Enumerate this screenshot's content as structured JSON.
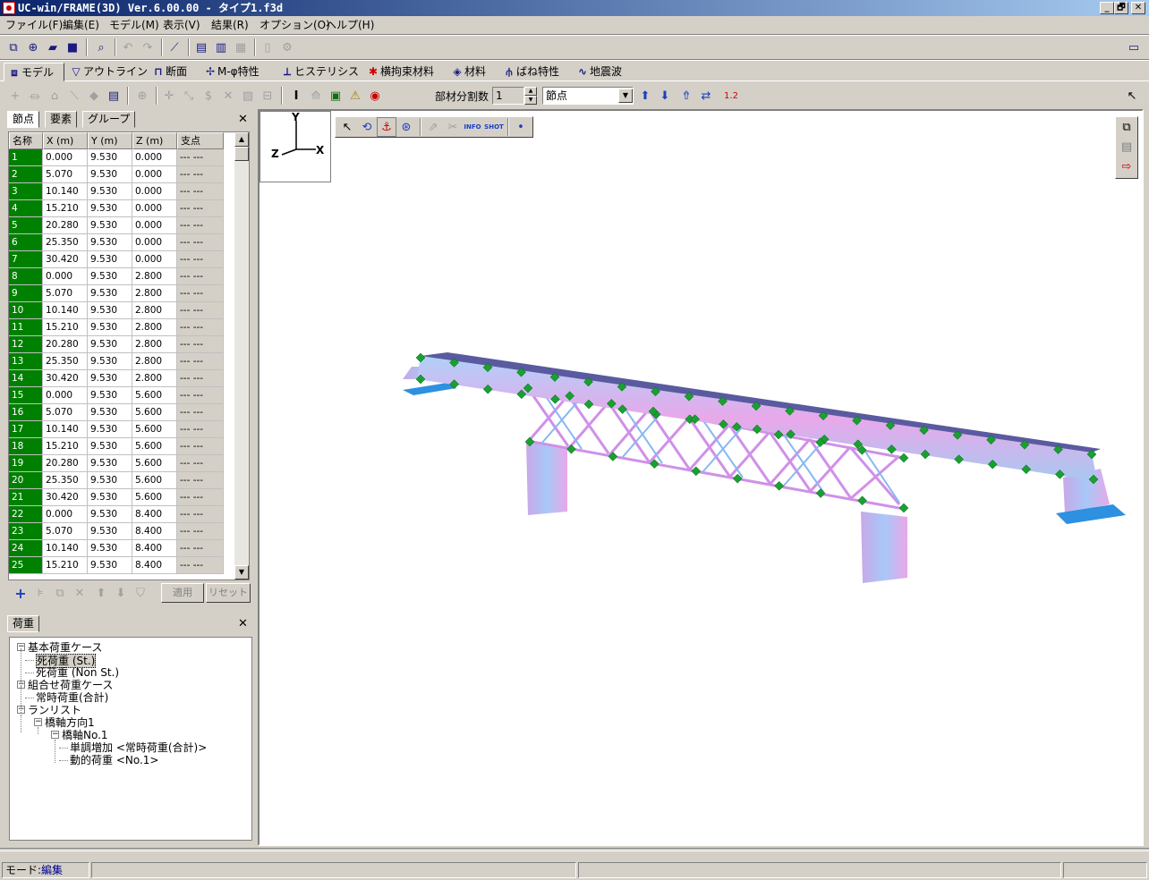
{
  "window": {
    "title": "UC-win/FRAME(3D) Ver.6.00.00 - タイプ1.f3d",
    "min": "_",
    "max": "🗗",
    "close": "✕"
  },
  "menu": [
    "ファイル(F)",
    "編集(E)",
    "モデル(M)",
    "表示(V)",
    "結果(R)",
    "オプション(O)",
    "ヘルプ(H)"
  ],
  "tabs": [
    {
      "label": "モデル",
      "icon": "model-icon"
    },
    {
      "label": "アウトライン",
      "icon": "outline-icon"
    },
    {
      "label": "断面",
      "icon": "section-icon"
    },
    {
      "label": "M-φ特性",
      "icon": "m-phi-icon"
    },
    {
      "label": "ヒステリシス",
      "icon": "hysteresis-icon"
    },
    {
      "label": "横拘束材料",
      "icon": "confinement-icon"
    },
    {
      "label": "材料",
      "icon": "material-icon"
    },
    {
      "label": "ばね特性",
      "icon": "spring-icon"
    },
    {
      "label": "地震波",
      "icon": "wave-icon"
    }
  ],
  "toolbar2": {
    "divide_label": "部材分割数",
    "divide_value": "1",
    "mode_select": "節点"
  },
  "node_panel": {
    "tabs": [
      "節点",
      "要素",
      "グループ"
    ],
    "close": "✕",
    "columns": [
      "名称",
      "X (m)",
      "Y (m)",
      "Z (m)",
      "支点"
    ],
    "rows": [
      [
        "1",
        "0.000",
        "9.530",
        "0.000",
        "--- ---"
      ],
      [
        "2",
        "5.070",
        "9.530",
        "0.000",
        "--- ---"
      ],
      [
        "3",
        "10.140",
        "9.530",
        "0.000",
        "--- ---"
      ],
      [
        "4",
        "15.210",
        "9.530",
        "0.000",
        "--- ---"
      ],
      [
        "5",
        "20.280",
        "9.530",
        "0.000",
        "--- ---"
      ],
      [
        "6",
        "25.350",
        "9.530",
        "0.000",
        "--- ---"
      ],
      [
        "7",
        "30.420",
        "9.530",
        "0.000",
        "--- ---"
      ],
      [
        "8",
        "0.000",
        "9.530",
        "2.800",
        "--- ---"
      ],
      [
        "9",
        "5.070",
        "9.530",
        "2.800",
        "--- ---"
      ],
      [
        "10",
        "10.140",
        "9.530",
        "2.800",
        "--- ---"
      ],
      [
        "11",
        "15.210",
        "9.530",
        "2.800",
        "--- ---"
      ],
      [
        "12",
        "20.280",
        "9.530",
        "2.800",
        "--- ---"
      ],
      [
        "13",
        "25.350",
        "9.530",
        "2.800",
        "--- ---"
      ],
      [
        "14",
        "30.420",
        "9.530",
        "2.800",
        "--- ---"
      ],
      [
        "15",
        "0.000",
        "9.530",
        "5.600",
        "--- ---"
      ],
      [
        "16",
        "5.070",
        "9.530",
        "5.600",
        "--- ---"
      ],
      [
        "17",
        "10.140",
        "9.530",
        "5.600",
        "--- ---"
      ],
      [
        "18",
        "15.210",
        "9.530",
        "5.600",
        "--- ---"
      ],
      [
        "19",
        "20.280",
        "9.530",
        "5.600",
        "--- ---"
      ],
      [
        "20",
        "25.350",
        "9.530",
        "5.600",
        "--- ---"
      ],
      [
        "21",
        "30.420",
        "9.530",
        "5.600",
        "--- ---"
      ],
      [
        "22",
        "0.000",
        "9.530",
        "8.400",
        "--- ---"
      ],
      [
        "23",
        "5.070",
        "9.530",
        "8.400",
        "--- ---"
      ],
      [
        "24",
        "10.140",
        "9.530",
        "8.400",
        "--- ---"
      ],
      [
        "25",
        "15.210",
        "9.530",
        "8.400",
        "--- ---"
      ]
    ],
    "apply": "適用",
    "reset": "リセット"
  },
  "load_panel": {
    "tab": "荷重",
    "close": "✕",
    "tree": [
      {
        "label": "基本荷重ケース",
        "level": 0,
        "box": "−"
      },
      {
        "label": "死荷重 (St.)",
        "level": 1,
        "selected": true
      },
      {
        "label": "死荷重 (Non St.)",
        "level": 1
      },
      {
        "label": "組合せ荷重ケース",
        "level": 0,
        "box": "−"
      },
      {
        "label": "常時荷重(合計)",
        "level": 1
      },
      {
        "label": "ランリスト",
        "level": 0,
        "box": "−"
      },
      {
        "label": "橋軸方向1",
        "level": 1,
        "box": "−"
      },
      {
        "label": "橋軸No.1",
        "level": 2,
        "box": "−"
      },
      {
        "label": "単調増加 <常時荷重(合計)>",
        "level": 3
      },
      {
        "label": "動的荷重 <No.1>",
        "level": 3
      }
    ]
  },
  "axes": {
    "y": "Y",
    "x": "X",
    "z": "Z"
  },
  "viewtools": [
    "arrow-icon",
    "rotate-icon",
    "anchor-icon",
    "zoom-icon",
    "pan-icon",
    "measure-icon",
    "INFO",
    "SHOT",
    "dot-icon"
  ],
  "status": {
    "mode_label": "モード:",
    "mode_value": "編集"
  },
  "colors": {
    "accent": "#0a246a",
    "node_green": "#008000",
    "member_pink": "#e6a0e6",
    "member_blue": "#a0c8f0"
  }
}
